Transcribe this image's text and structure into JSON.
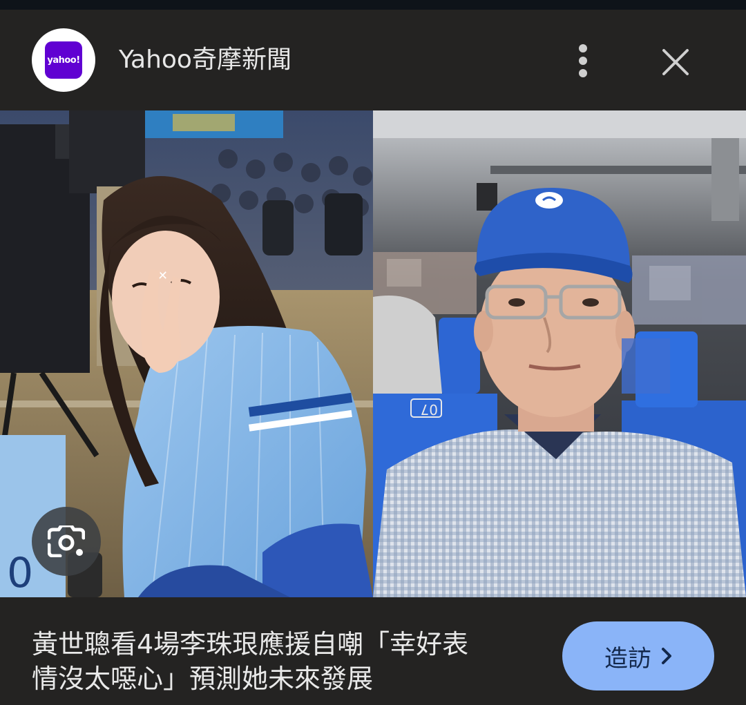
{
  "header": {
    "logo_text": "yahoo!",
    "source_name": "Yahoo奇摩新聞",
    "more_icon": "more-vertical-icon",
    "close_icon": "close-icon"
  },
  "image": {
    "lens_icon": "google-lens-icon",
    "left_photo_seat_number": "07"
  },
  "article": {
    "headline_line1": "黃世聰看4場李珠珢應援自嘲「幸好表",
    "headline_line2": "情沒太噁心」預測她未來發展"
  },
  "visit_button": {
    "label": "造訪",
    "icon": "chevron-right-icon"
  },
  "colors": {
    "card_background": "#242322",
    "visit_button_background": "#8ab4f8",
    "yahoo_purple": "#6001d2"
  }
}
